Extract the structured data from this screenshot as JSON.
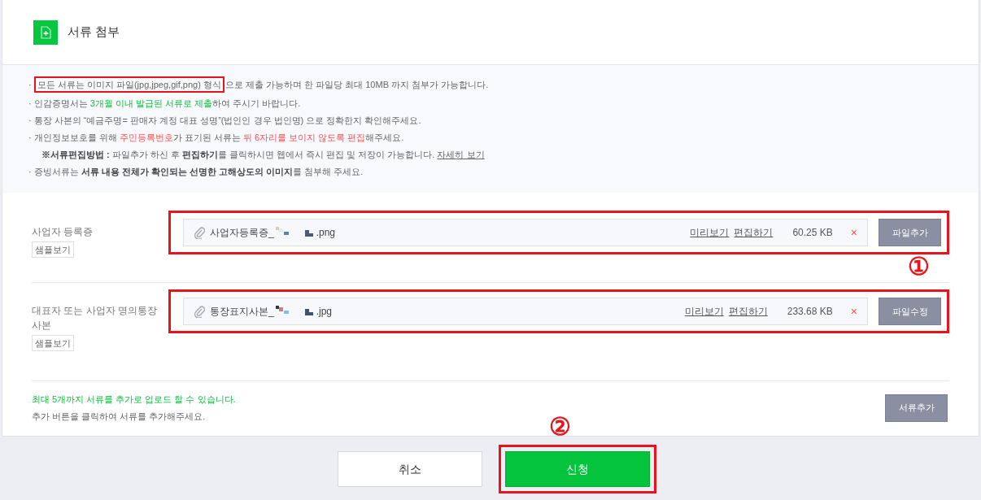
{
  "header": {
    "title": "서류 첨부"
  },
  "notices": [
    {
      "indent": false,
      "segments": [
        {
          "text": "· ",
          "kind": "plain",
          "highlighted": false
        },
        {
          "text": "모든 서류는 이미지 파일(jpg,jpeg,gif,png) 형식",
          "kind": "plain",
          "highlighted": true
        },
        {
          "text": "으로 제출 가능하며 한 파일당 최대 10MB 까지 첨부가 가능합니다.",
          "kind": "plain",
          "highlighted": false
        }
      ]
    },
    {
      "indent": false,
      "segments": [
        {
          "text": "· 인감증명서는 ",
          "kind": "plain"
        },
        {
          "text": "3개월 이내 발급된 서류로 제출",
          "kind": "green"
        },
        {
          "text": "하여 주시기 바랍니다.",
          "kind": "plain"
        }
      ]
    },
    {
      "indent": false,
      "segments": [
        {
          "text": "· 통장 사본의 “예금주명= 판매자 계정 대표 성명”(법인인 경우 법인명) 으로 정확한지 확인해주세요.",
          "kind": "plain"
        }
      ]
    },
    {
      "indent": false,
      "segments": [
        {
          "text": "· 개인정보보호를 위해 ",
          "kind": "plain"
        },
        {
          "text": "주민등록번호",
          "kind": "red"
        },
        {
          "text": "가 표기된 서류는 ",
          "kind": "plain"
        },
        {
          "text": "뒤 6자리를 보이지 않도록 편집",
          "kind": "red"
        },
        {
          "text": "해주세요.",
          "kind": "plain"
        }
      ]
    },
    {
      "indent": true,
      "segments": [
        {
          "text": "※서류편집방법 :",
          "kind": "bold"
        },
        {
          "text": " 파일추가 하신 후 ",
          "kind": "plain"
        },
        {
          "text": "편집하기",
          "kind": "bold"
        },
        {
          "text": "를 클릭하시면 웹에서 즉시 편집 및 저장이 가능합니다. ",
          "kind": "plain"
        }
      ],
      "link": "자세히 보기"
    },
    {
      "indent": false,
      "segments": [
        {
          "text": "· 증빙서류는 ",
          "kind": "plain"
        },
        {
          "text": "서류 내용 전체가 확인되는 선명한 고해상도의 이미지",
          "kind": "bold"
        },
        {
          "text": "를 첨부해 주세요.",
          "kind": "plain"
        }
      ]
    }
  ],
  "documents": [
    {
      "label": "사업자 등록증",
      "sample": "샘플보기",
      "file_prefix": "사업자등록증_",
      "file_suffix": ".png",
      "preview": "미리보기",
      "edit": "편집하기",
      "size": "60.25 KB",
      "remove": "×",
      "button": "파일추가",
      "highlighted": true
    },
    {
      "label": "대표자 또는 사업자 명의통장 사본",
      "sample": "샘플보기",
      "file_prefix": "통장표지사본_",
      "file_suffix": ".jpg",
      "preview": "미리보기",
      "edit": "편집하기",
      "size": "233.68 KB",
      "remove": "×",
      "button": "파일수정",
      "highlighted": true
    }
  ],
  "add_more": {
    "note": "최대 5개까지 서류를 추가로 업로드 할 수 있습니다.",
    "hint": "추가 버튼을 클릭하여 서류를 추가해주세요.",
    "button": "서류추가"
  },
  "actions": [
    {
      "label": "취소",
      "kind": "secondary",
      "highlighted": false
    },
    {
      "label": "신청",
      "kind": "primary",
      "highlighted": true
    }
  ],
  "step_marks": [
    "①",
    "②"
  ]
}
